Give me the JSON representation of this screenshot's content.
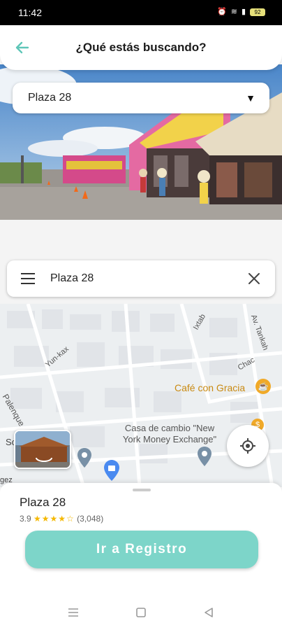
{
  "status_bar": {
    "time": "11:42",
    "battery": "92"
  },
  "header": {
    "title": "¿Qué estás buscando?"
  },
  "place_dropdown": {
    "selected": "Plaza 28"
  },
  "search": {
    "value": "Plaza 28"
  },
  "map": {
    "streets": [
      "Yun-kax",
      "Ixtab",
      "Av. Tankah",
      "Chac",
      "Palenque"
    ],
    "pois": [
      {
        "name": "Café con Gracia"
      },
      {
        "name": "Casa de cambio \"New\nYork Money Exchange\""
      },
      {
        "name": "So...gitales"
      }
    ],
    "edge_text": "gez"
  },
  "sheet": {
    "place_name": "Plaza 28",
    "rating_value": "3.9",
    "rating_count": "(3,048)"
  },
  "cta": {
    "label": "Ir a Registro"
  },
  "colors": {
    "accent": "#7dd5c9",
    "back_arrow": "#5fc6b8"
  }
}
